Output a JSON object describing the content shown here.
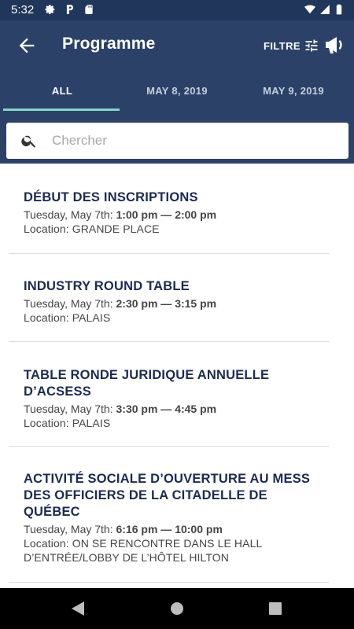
{
  "status_bar": {
    "time": "5:32",
    "icons": [
      "settings-icon",
      "parking-icon",
      "sd-card-icon",
      "wifi-icon",
      "signal-icon",
      "battery-icon"
    ]
  },
  "app_bar": {
    "title": "Programme",
    "filter_label": "FILTRE",
    "icons": [
      "back-arrow-icon",
      "filter-sliders-icon",
      "megaphone-icon"
    ]
  },
  "tabs": [
    {
      "label": "ALL",
      "active": true
    },
    {
      "label": "MAY 8, 2019",
      "active": false
    },
    {
      "label": "MAY 9, 2019",
      "active": false
    }
  ],
  "search": {
    "placeholder": "Chercher",
    "value": ""
  },
  "events": [
    {
      "title_lines": [
        "DÉBUT DES INSCRIPTIONS"
      ],
      "day": "Tuesday, May 7th: ",
      "time": "1:00 pm — 2:00 pm",
      "location_lines": [
        "Location: GRANDE PLACE"
      ]
    },
    {
      "title_lines": [
        "INDUSTRY ROUND TABLE"
      ],
      "day": "Tuesday, May 7th: ",
      "time": "2:30 pm — 3:15 pm",
      "location_lines": [
        "Location: PALAIS"
      ]
    },
    {
      "title_lines": [
        "TABLE RONDE JURIDIQUE ANNUELLE",
        "D’ACSESS"
      ],
      "day": "Tuesday, May 7th: ",
      "time": "3:30 pm — 4:45 pm",
      "location_lines": [
        "Location: PALAIS"
      ]
    },
    {
      "title_lines": [
        "ACTIVITÉ SOCIALE D’OUVERTURE AU MESS",
        "DES OFFICIERS DE LA CITADELLE DE",
        "QUÉBEC"
      ],
      "day": "Tuesday, May 7th: ",
      "time": "6:16 pm — 10:00 pm",
      "location_lines": [
        "Location: ON SE RENCONTRE DANS LE HALL",
        "D’ENTRÉE/LOBBY DE L’HÔTEL HILTON"
      ]
    }
  ],
  "nav_bar": {
    "icons": [
      "back-triangle-icon",
      "home-circle-icon",
      "recents-square-icon"
    ]
  },
  "colors": {
    "status_bar": "#20365a",
    "app_bar": "#2b4167",
    "tab_indicator": "#7fd8c8",
    "event_title": "#1b2a55"
  }
}
